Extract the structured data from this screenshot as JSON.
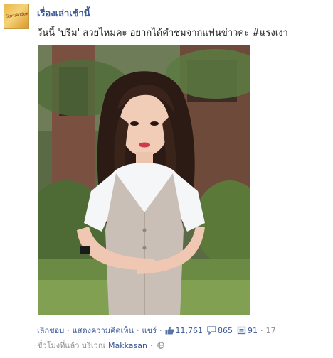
{
  "post": {
    "page_name": "เรื่องเล่าเช้านี้",
    "avatar_text": "Sarakadee",
    "caption": "วันนี้ 'ปริม' สวยไหมคะ อยากได้คำชมจากแฟนข่าวค่ะ #แรงเงา",
    "photo_icon": "photo-of-woman-in-university-uniform"
  },
  "actions": {
    "unlike_label": "เลิกชอบ",
    "comment_label": "แสดงความคิดเห็น",
    "share_label": "แชร์",
    "likes_count": "11,761",
    "comments_count": "865",
    "shares_count": "91",
    "trailing_number": "17",
    "like_icon": "thumbs-up-icon",
    "comment_icon": "comment-icon",
    "share_icon": "share-icon",
    "separator": "·"
  },
  "meta": {
    "time_text": "ชั่วโมงที่แล้ว บริเวณ",
    "location": "Makkasan",
    "separator": "·",
    "audience_icon": "globe-icon"
  }
}
